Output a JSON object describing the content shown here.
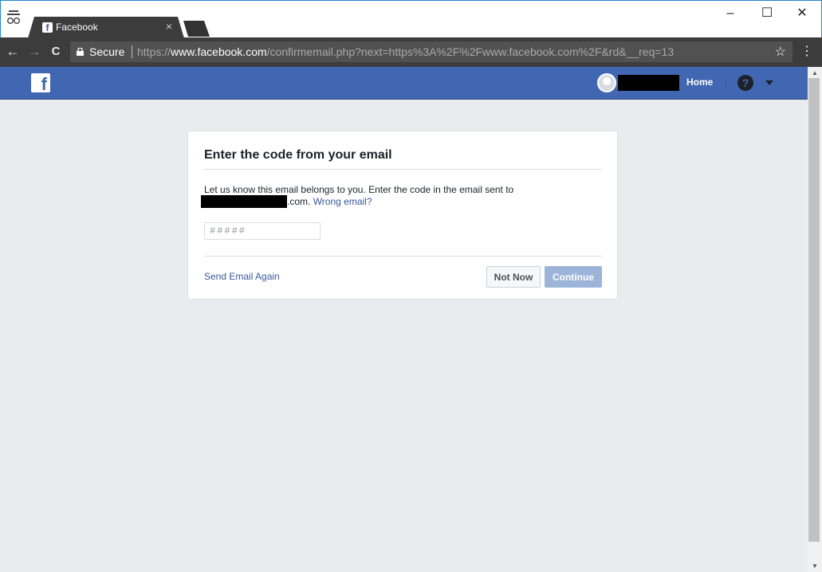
{
  "browser": {
    "tab_title": "Facebook",
    "tab_favicon": "f",
    "tab_close": "×",
    "window_minimize": "–",
    "window_maximize": "☐",
    "window_close": "✕",
    "nav_back": "←",
    "nav_forward": "→",
    "nav_reload": "C",
    "secure_label": "Secure",
    "url_scheme": "https://",
    "url_host": "www.facebook.com",
    "url_path": "/confirmemail.php?next=https%3A%2F%2Fwww.facebook.com%2F&rd&__req=13",
    "bookmark_star": "☆",
    "menu_kebab": "⋮"
  },
  "fb_header": {
    "logo": "f",
    "home_label": "Home",
    "help_label": "?"
  },
  "dialog": {
    "title": "Enter the code from your email",
    "message_line1": "Let us know this email belongs to you. Enter the code in the email sent to",
    "email_suffix": ".com.",
    "wrong_email_link": "Wrong email?",
    "code_placeholder": "#####",
    "code_value": "",
    "send_again_link": "Send Email Again",
    "not_now_label": "Not Now",
    "continue_label": "Continue"
  },
  "colors": {
    "fb_blue": "#4267b2",
    "page_bg": "#e9ebee",
    "link": "#365899",
    "continue_disabled": "#9cb4d8"
  }
}
